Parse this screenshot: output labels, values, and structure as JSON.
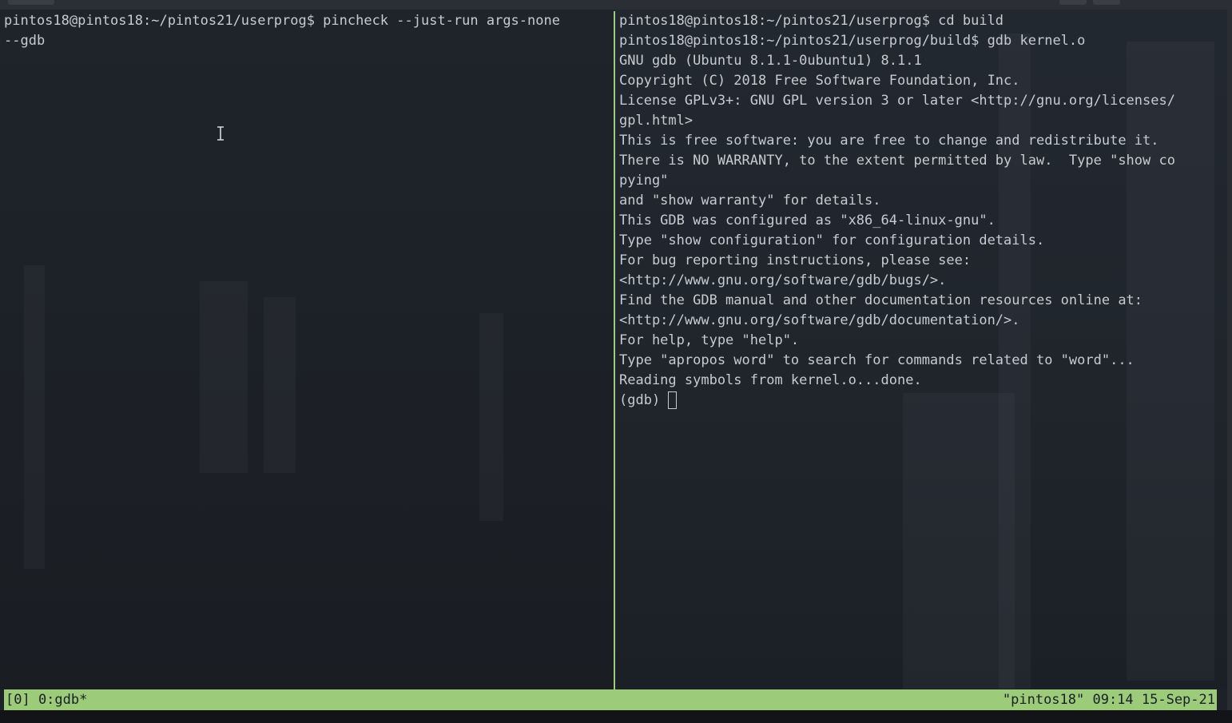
{
  "window": {
    "title": ""
  },
  "left_pane": {
    "lines": [
      "pintos18@pintos18:~/pintos21/userprog$ pincheck --just-run args-none",
      "--gdb"
    ]
  },
  "right_pane": {
    "lines": [
      "pintos18@pintos18:~/pintos21/userprog$ cd build",
      "pintos18@pintos18:~/pintos21/userprog/build$ gdb kernel.o",
      "GNU gdb (Ubuntu 8.1.1-0ubuntu1) 8.1.1",
      "Copyright (C) 2018 Free Software Foundation, Inc.",
      "License GPLv3+: GNU GPL version 3 or later <http://gnu.org/licenses/",
      "gpl.html>",
      "This is free software: you are free to change and redistribute it.",
      "There is NO WARRANTY, to the extent permitted by law.  Type \"show co",
      "pying\"",
      "and \"show warranty\" for details.",
      "This GDB was configured as \"x86_64-linux-gnu\".",
      "Type \"show configuration\" for configuration details.",
      "For bug reporting instructions, please see:",
      "<http://www.gnu.org/software/gdb/bugs/>.",
      "Find the GDB manual and other documentation resources online at:",
      "<http://www.gnu.org/software/gdb/documentation/>.",
      "For help, type \"help\".",
      "Type \"apropos word\" to search for commands related to \"word\"...",
      "Reading symbols from kernel.o...done."
    ],
    "prompt": "(gdb)"
  },
  "status_bar": {
    "left": "[0] 0:gdb*",
    "right": "\"pintos18\" 09:14 15-Sep-21"
  },
  "colors": {
    "status_bar_bg": "#9ccc7a",
    "pane_divider": "#9ccc7a",
    "terminal_text": "#c7cbd0",
    "terminal_bg": "#1d2229"
  },
  "icons": {
    "mouse_cursor": "ibeam-cursor-icon",
    "text_cursor": "block-cursor"
  }
}
